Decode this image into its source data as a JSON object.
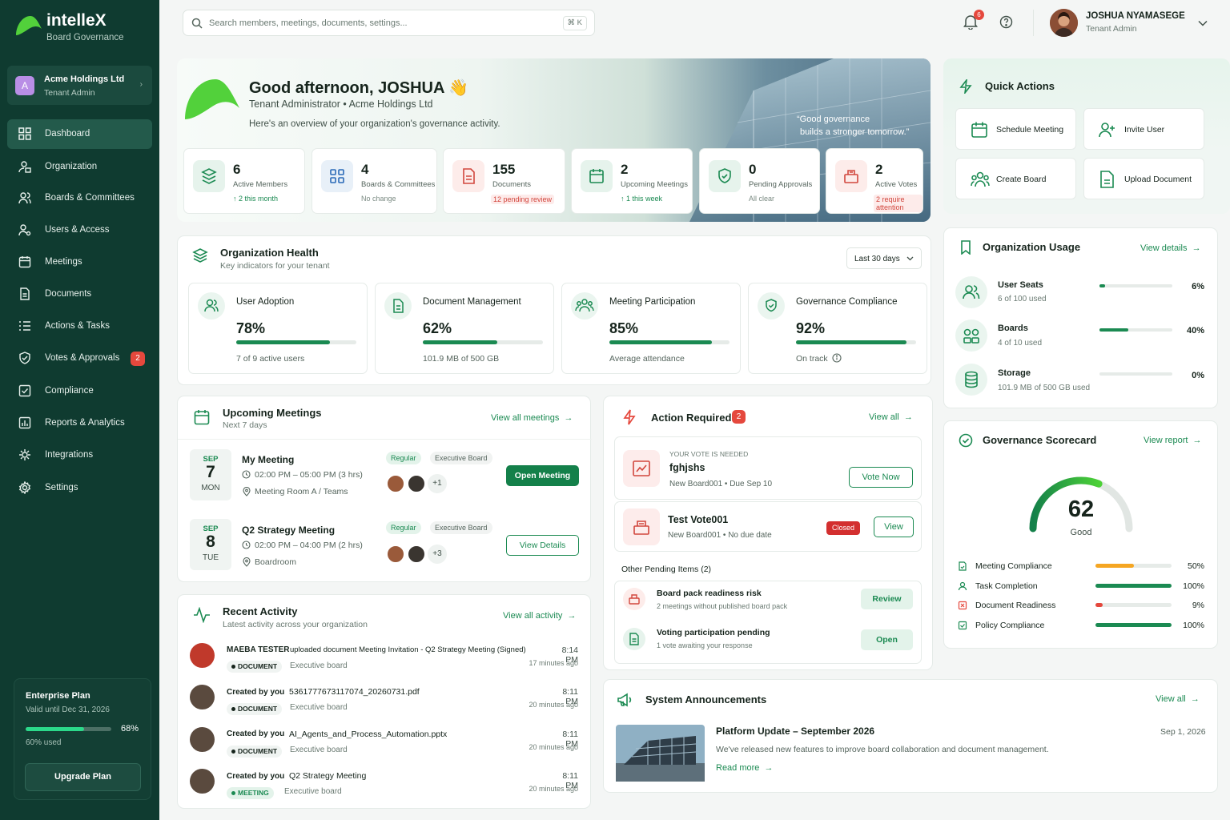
{
  "brand": {
    "name": "intelleX",
    "tagline": "Board Governance"
  },
  "org_switcher": {
    "initials": "A",
    "name": "Acme Holdings Ltd",
    "role": "Tenant Admin"
  },
  "nav": [
    {
      "label": "Dashboard",
      "icon": "grid-icon",
      "active": true
    },
    {
      "label": "Organization",
      "icon": "organization-icon"
    },
    {
      "label": "Boards & Committees",
      "icon": "users-group-icon"
    },
    {
      "label": "Users & Access",
      "icon": "user-key-icon"
    },
    {
      "label": "Meetings",
      "icon": "calendar-icon"
    },
    {
      "label": "Documents",
      "icon": "document-icon"
    },
    {
      "label": "Actions & Tasks",
      "icon": "list-check-icon"
    },
    {
      "label": "Votes & Approvals",
      "icon": "shield-check-icon",
      "badge": "2"
    },
    {
      "label": "Compliance",
      "icon": "checkbox-icon"
    },
    {
      "label": "Reports & Analytics",
      "icon": "chart-icon"
    },
    {
      "label": "Integrations",
      "icon": "integrations-icon"
    },
    {
      "label": "Settings",
      "icon": "gear-icon"
    }
  ],
  "plan": {
    "title": "Enterprise Plan",
    "valid": "Valid until Dec 31, 2026",
    "percent_label": "68%",
    "percent": 0.68,
    "used": "60% used",
    "button": "Upgrade Plan"
  },
  "header": {
    "search_placeholder": "Search members, meetings, documents, settings...",
    "shortcut": "⌘ K",
    "notifications": "6",
    "user_name": "JOSHUA NYAMASEGE",
    "user_role": "Tenant Admin"
  },
  "hero": {
    "greeting": "Good afternoon, JOSHUA 👋",
    "role_line": "Tenant Administrator  •  Acme Holdings Ltd",
    "overview": "Here's an overview of your organization's governance activity.",
    "quote_line1": "“Good governance",
    "quote_line2": "builds a stronger tomorrow.”",
    "stats": [
      {
        "value": "6",
        "label": "Active Members",
        "sub": "↑  2 this month",
        "tone": "green",
        "icon": "members-icon"
      },
      {
        "value": "4",
        "label": "Boards & Committees",
        "sub": "No change",
        "tone": "grey",
        "icon": "boards-icon"
      },
      {
        "value": "155",
        "label": "Documents",
        "sub": "12 pending review",
        "tone": "red",
        "icon": "document-icon"
      },
      {
        "value": "2",
        "label": "Upcoming Meetings",
        "sub": "↑  1 this week",
        "tone": "green",
        "icon": "calendar-icon"
      },
      {
        "value": "0",
        "label": "Pending Approvals",
        "sub": "All clear",
        "tone": "grey",
        "icon": "shield-check-icon"
      },
      {
        "value": "2",
        "label": "Active Votes",
        "sub": "2 require attention",
        "tone": "red",
        "icon": "ballot-icon"
      }
    ]
  },
  "quick_actions": {
    "title": "Quick Actions",
    "items": [
      {
        "label": "Schedule Meeting",
        "icon": "calendar-icon"
      },
      {
        "label": "Invite User",
        "icon": "user-plus-icon"
      },
      {
        "label": "Create Board",
        "icon": "users-group-icon"
      },
      {
        "label": "Upload Document",
        "icon": "document-icon"
      }
    ]
  },
  "health": {
    "title": "Organization Health",
    "subtitle": "Key indicators for your tenant",
    "period": "Last 30 days",
    "items": [
      {
        "title": "User Adoption",
        "value": "78%",
        "pct": 0.78,
        "sub": "7 of 9 active users",
        "icon": "users-icon"
      },
      {
        "title": "Document Management",
        "value": "62%",
        "pct": 0.62,
        "sub": "101.9 MB of 500 GB",
        "icon": "document-icon"
      },
      {
        "title": "Meeting Participation",
        "value": "85%",
        "pct": 0.85,
        "sub": "Average attendance",
        "icon": "users-group-icon"
      },
      {
        "title": "Governance Compliance",
        "value": "92%",
        "pct": 0.92,
        "sub": "On track",
        "icon": "shield-check-icon"
      }
    ]
  },
  "usage": {
    "title": "Organization Usage",
    "link": "View details",
    "items": [
      {
        "title": "User Seats",
        "sub": "6 of 100 used",
        "pct_label": "6%",
        "pct": 0.06,
        "icon": "users-icon"
      },
      {
        "title": "Boards",
        "sub": "4 of 10 used",
        "pct_label": "40%",
        "pct": 0.4,
        "icon": "boards-icon"
      },
      {
        "title": "Storage",
        "sub": "101.9 MB of 500 GB used",
        "pct_label": "0%",
        "pct": 0.0,
        "icon": "database-icon"
      }
    ]
  },
  "meetings": {
    "title": "Upcoming Meetings",
    "subtitle": "Next 7 days",
    "link": "View all meetings",
    "items": [
      {
        "month": "SEP",
        "day": "7",
        "weekday": "MON",
        "title": "My Meeting",
        "time": "02:00 PM – 05:00 PM (3 hrs)",
        "location": "Meeting Room A / Teams",
        "type": "Regular",
        "board": "Executive Board",
        "more": "+1",
        "action": "Open Meeting"
      },
      {
        "month": "SEP",
        "day": "8",
        "weekday": "TUE",
        "title": "Q2 Strategy Meeting",
        "time": "02:00 PM – 04:00 PM (2 hrs)",
        "location": "Boardroom",
        "type": "Regular",
        "board": "Executive Board",
        "more": "+3",
        "action": "View Details"
      }
    ]
  },
  "activity": {
    "title": "Recent Activity",
    "subtitle": "Latest activity across your organization",
    "link": "View all activity",
    "items": [
      {
        "who": "MAEBA TESTER",
        "what": "uploaded document  Meeting Invitation - Q2 Strategy Meeting (Signed)",
        "tag": "DOCUMENT",
        "board": "Executive board",
        "time": "8:14 PM",
        "ago": "17 minutes ago"
      },
      {
        "who": "Created by you",
        "what": "5361777673117074_20260731.pdf",
        "tag": "DOCUMENT",
        "board": "Executive board",
        "time": "8:11 PM",
        "ago": "20 minutes ago"
      },
      {
        "who": "Created by you",
        "what": "AI_Agents_and_Process_Automation.pptx",
        "tag": "DOCUMENT",
        "board": "Executive board",
        "time": "8:11 PM",
        "ago": "20 minutes ago"
      },
      {
        "who": "Created by you",
        "what": "Q2 Strategy Meeting",
        "tag": "MEETING",
        "board": "Executive board",
        "time": "8:11 PM",
        "ago": "20 minutes ago"
      }
    ]
  },
  "action_required": {
    "title": "Action Required",
    "count": "2",
    "link": "View all",
    "vote": {
      "eyebrow": "YOUR VOTE IS NEEDED",
      "title": "fghjshs",
      "meta": "New Board001  •  Due Sep 10",
      "button": "Vote Now"
    },
    "closed": {
      "title": "Test Vote001",
      "meta": "New Board001  •  No due date",
      "status": "Closed",
      "button": "View"
    },
    "other_title": "Other Pending Items (2)",
    "pending": [
      {
        "title": "Board pack readiness risk",
        "sub": "2 meetings without published board pack",
        "button": "Review"
      },
      {
        "title": "Voting participation pending",
        "sub": "1 vote awaiting your response",
        "button": "Open"
      }
    ]
  },
  "scorecard": {
    "title": "Governance Scorecard",
    "link": "View report",
    "score": "62",
    "score_value": 62,
    "rating": "Good",
    "items": [
      {
        "label": "Meeting Compliance",
        "pct_label": "50%",
        "pct": 0.5,
        "color": "#f5a623"
      },
      {
        "label": "Task Completion",
        "pct_label": "100%",
        "pct": 1.0,
        "color": "#1b8a52"
      },
      {
        "label": "Document Readiness",
        "pct_label": "9%",
        "pct": 0.09,
        "color": "#e5483d"
      },
      {
        "label": "Policy Compliance",
        "pct_label": "100%",
        "pct": 1.0,
        "color": "#1b8a52"
      }
    ]
  },
  "announcements": {
    "title": "System Announcements",
    "link": "View all",
    "item": {
      "title": "Platform Update – September 2026",
      "date": "Sep 1, 2026",
      "body": "We've released new features to improve board collaboration and document management.",
      "link": "Read more"
    }
  },
  "colors": {
    "sidebar": "#0f3b30",
    "accent": "#1b8a52",
    "danger": "#e5483d",
    "warning": "#f5a623"
  }
}
